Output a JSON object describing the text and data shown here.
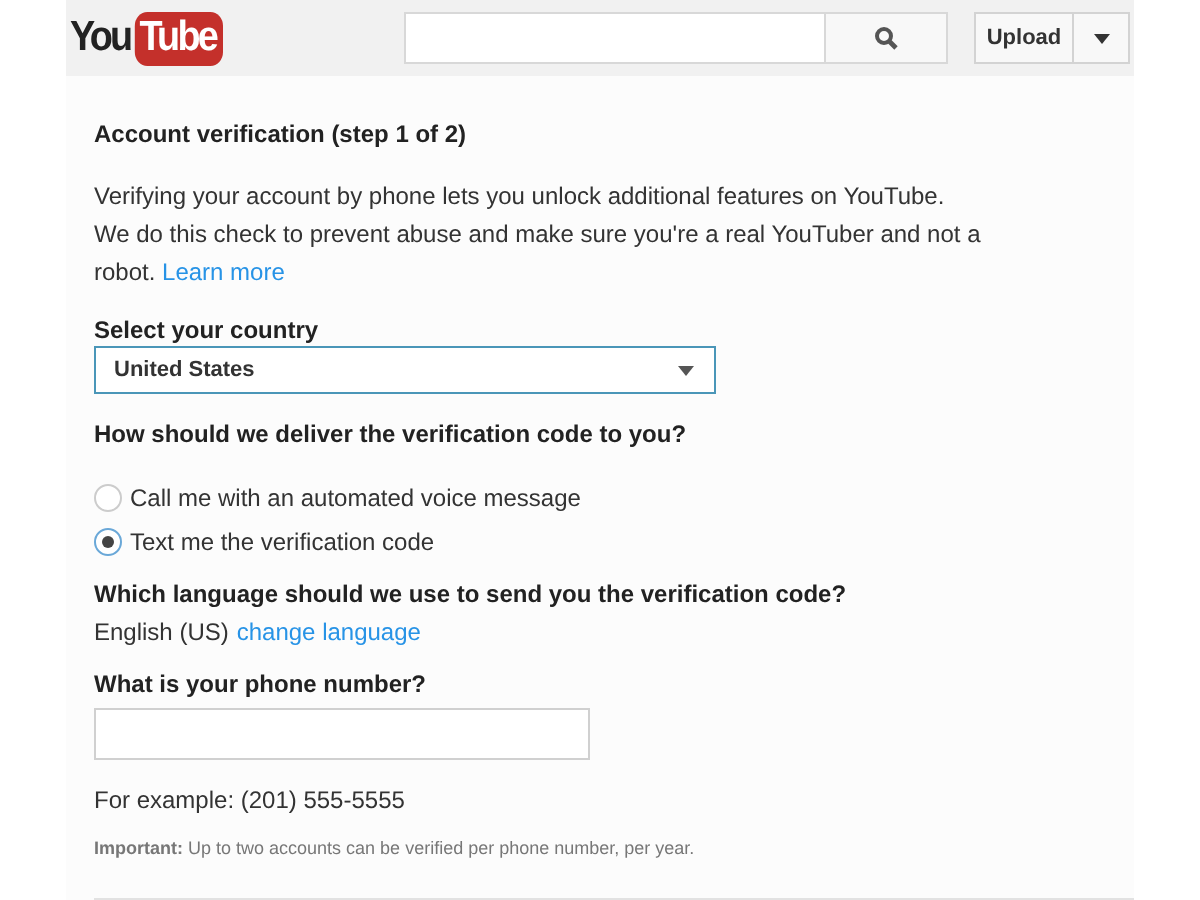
{
  "header": {
    "logo": {
      "left": "You",
      "right": "Tube"
    },
    "upload_button": "Upload"
  },
  "title": "Account verification (step 1 of 2)",
  "intro": "Verifying your account by phone lets you unlock additional features on YouTube.",
  "note": {
    "text": "We do this check to prevent abuse and make sure you're a real YouTuber and not a robot.",
    "link": "Learn more"
  },
  "country": {
    "label": "Select your country",
    "value": "United States"
  },
  "delivery": {
    "question": "How should we deliver the verification code to you?",
    "options": [
      {
        "label": "Call me with an automated voice message",
        "selected": false
      },
      {
        "label": "Text me the verification code",
        "selected": true
      }
    ]
  },
  "language": {
    "question": "Which language should we use to send you the verification code?",
    "value": "English (US)",
    "link": "change language"
  },
  "phone": {
    "label": "What is your phone number?",
    "example": "For example: (201) 555-5555"
  },
  "important": "**Important:** Up to two accounts can be verified per phone number, per year."
}
